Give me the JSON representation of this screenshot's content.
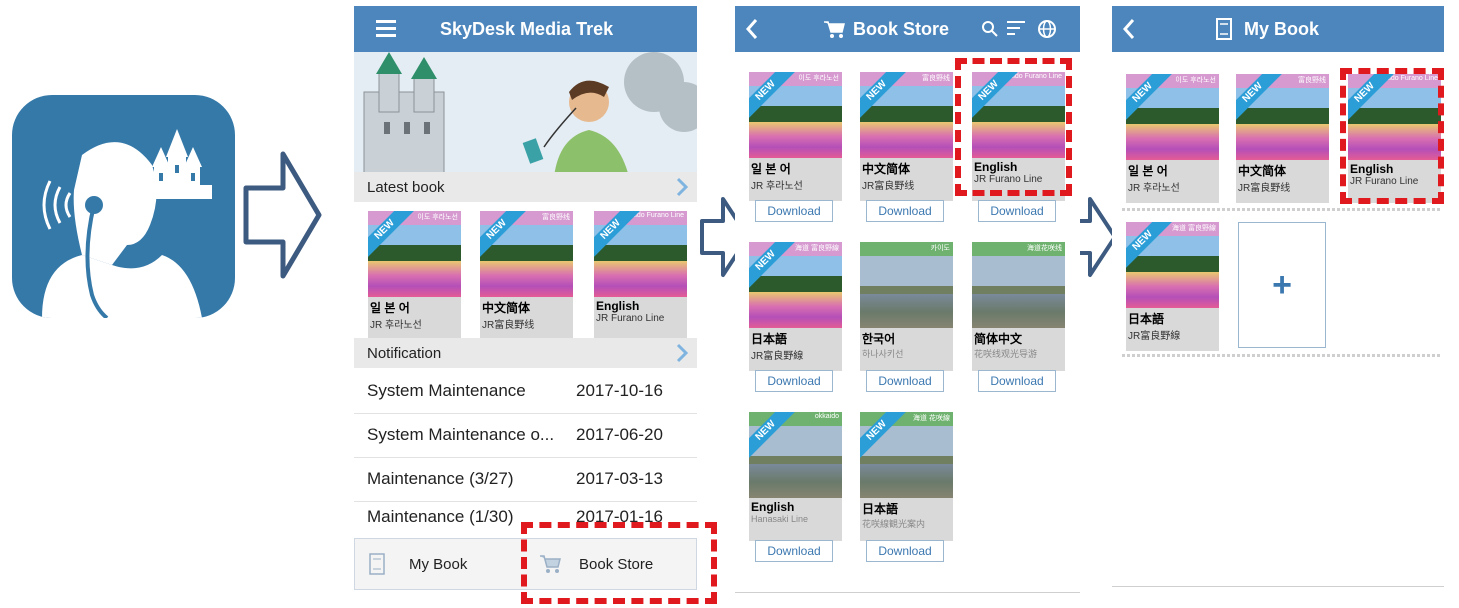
{
  "colors": {
    "header": "#4c86bd",
    "icon_bg": "#3579a9",
    "highlight": "#e0191e",
    "arrow": "#3d5a80"
  },
  "screen1": {
    "title": "SkyDesk Media Trek",
    "latest_header": "Latest book",
    "books": [
      {
        "name": "일 본 어",
        "sub": "JR 후라노선",
        "band": "이도 후라노선",
        "ribbon": "NEW"
      },
      {
        "name": "中文简体",
        "sub": "JR富良野线",
        "band": "富良野线",
        "ribbon": "NEW"
      },
      {
        "name": "English",
        "sub": "JR Furano Line",
        "band": "aido Furano Line",
        "ribbon": "NEW"
      }
    ],
    "notification_header": "Notification",
    "notifications": [
      {
        "title": "System Maintenance",
        "date": "2017-10-16"
      },
      {
        "title": "System Maintenance o...",
        "date": "2017-06-20"
      },
      {
        "title": "Maintenance (3/27)",
        "date": "2017-03-13"
      },
      {
        "title": "Maintenance (1/30)",
        "date": "2017-01-16"
      }
    ],
    "tabs": {
      "mybook": "My Book",
      "bookstore": "Book Store"
    }
  },
  "screen2": {
    "title": "Book Store",
    "download_label": "Download",
    "books": [
      {
        "name": "일 본 어",
        "sub": "JR 후라노선",
        "band": "이도 후라노선",
        "ribbon": "NEW"
      },
      {
        "name": "中文简体",
        "sub": "JR富良野线",
        "band": "富良野线",
        "ribbon": "NEW"
      },
      {
        "name": "English",
        "sub": "JR  Furano  Line",
        "band": "aido Furano Line",
        "ribbon": "NEW"
      },
      {
        "name": "日本語",
        "sub": "JR富良野線",
        "band": "海道 富良野線",
        "ribbon": "NEW"
      },
      {
        "name": "한국어",
        "sub": "하나사키선",
        "band": "카이도",
        "ribbon": ""
      },
      {
        "name": "简体中文",
        "sub": "花咲线观光导游",
        "band": "海道花咲线",
        "ribbon": ""
      },
      {
        "name": "English",
        "sub": "Hanasaki Line",
        "band": "okkaido",
        "ribbon": "NEW"
      },
      {
        "name": "日本語",
        "sub": "花咲線観光案内",
        "band": "海道 花咲線",
        "ribbon": "NEW"
      }
    ]
  },
  "screen3": {
    "title": "My Book",
    "books": [
      {
        "name": "일 본 어",
        "sub": "JR 후라노선",
        "band": "이도 후라노선",
        "ribbon": "NEW"
      },
      {
        "name": "中文简体",
        "sub": "JR富良野线",
        "band": "富良野线",
        "ribbon": "NEW"
      },
      {
        "name": "English",
        "sub": "JR  Furano  Line",
        "band": "aido Furano Line",
        "ribbon": "NEW"
      },
      {
        "name": "日本語",
        "sub": "JR富良野線",
        "band": "海道 富良野線",
        "ribbon": "NEW"
      }
    ],
    "add_label": "+"
  }
}
